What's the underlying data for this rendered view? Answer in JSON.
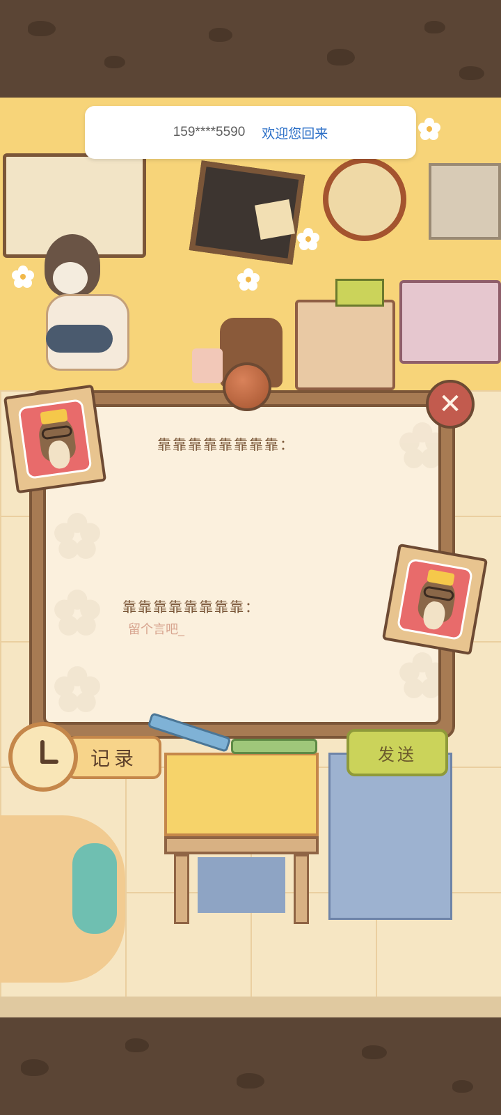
{
  "toast": {
    "phone": "159****5590",
    "welcome": "欢迎您回来"
  },
  "board": {
    "sender_label": "靠靠靠靠靠靠靠靠：",
    "receiver_label": "靠靠靠靠靠靠靠靠：",
    "message_placeholder": "留个言吧_"
  },
  "buttons": {
    "record_label": "记录",
    "send_label": "发送",
    "close_symbol": "✕"
  },
  "icons": {
    "close": "close-icon",
    "record": "clock-icon",
    "avatar": "avatar-icon"
  },
  "colors": {
    "accent_send": "#cbd35a",
    "close": "#c25b4e",
    "board_frame": "#a77b53",
    "link": "#2b6fc7"
  }
}
